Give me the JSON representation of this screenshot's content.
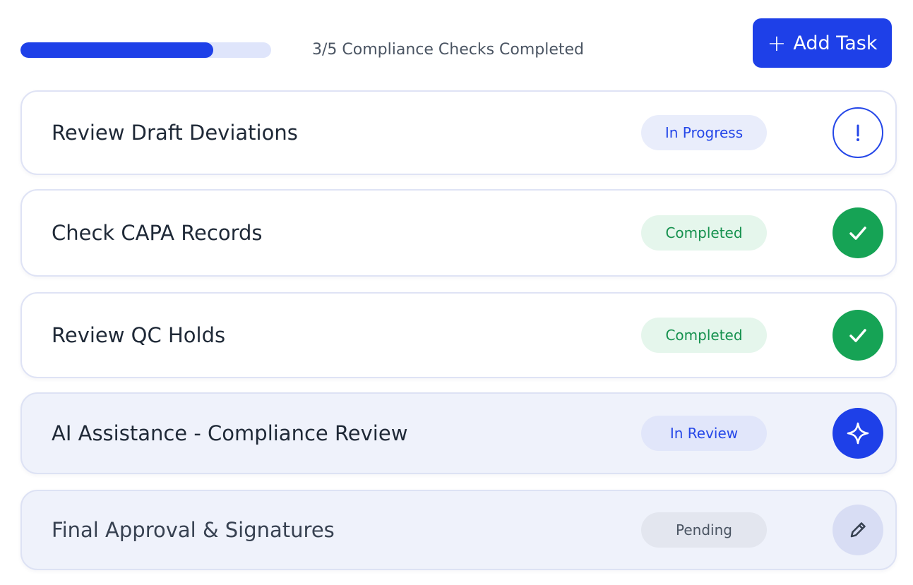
{
  "header": {
    "progress_text": "3/5 Compliance Checks Completed",
    "progress_fraction": 0.77,
    "add_button_icon": "plus-icon",
    "add_button_label": "Add Task",
    "add_button_plus": "+"
  },
  "tasks": [
    {
      "title": "Review Draft Deviations",
      "status": "In Progress",
      "icon": "alert-icon"
    },
    {
      "title": "Check CAPA Records",
      "status": "Completed",
      "icon": "checkmark-icon"
    },
    {
      "title": "Review QC Holds",
      "status": "Completed",
      "icon": "checkmark-icon"
    },
    {
      "title": "AI Assistance - Compliance Review",
      "status": "In Review",
      "icon": "sparkle-icon"
    },
    {
      "title": "Final Approval & Signatures",
      "status": "Pending",
      "icon": "pencil-icon"
    }
  ],
  "colors": {
    "accent": "#1e40e8",
    "success": "#16a355",
    "success_badge_bg": "#e5f6ec",
    "progress_track": "#dfe5fb"
  }
}
